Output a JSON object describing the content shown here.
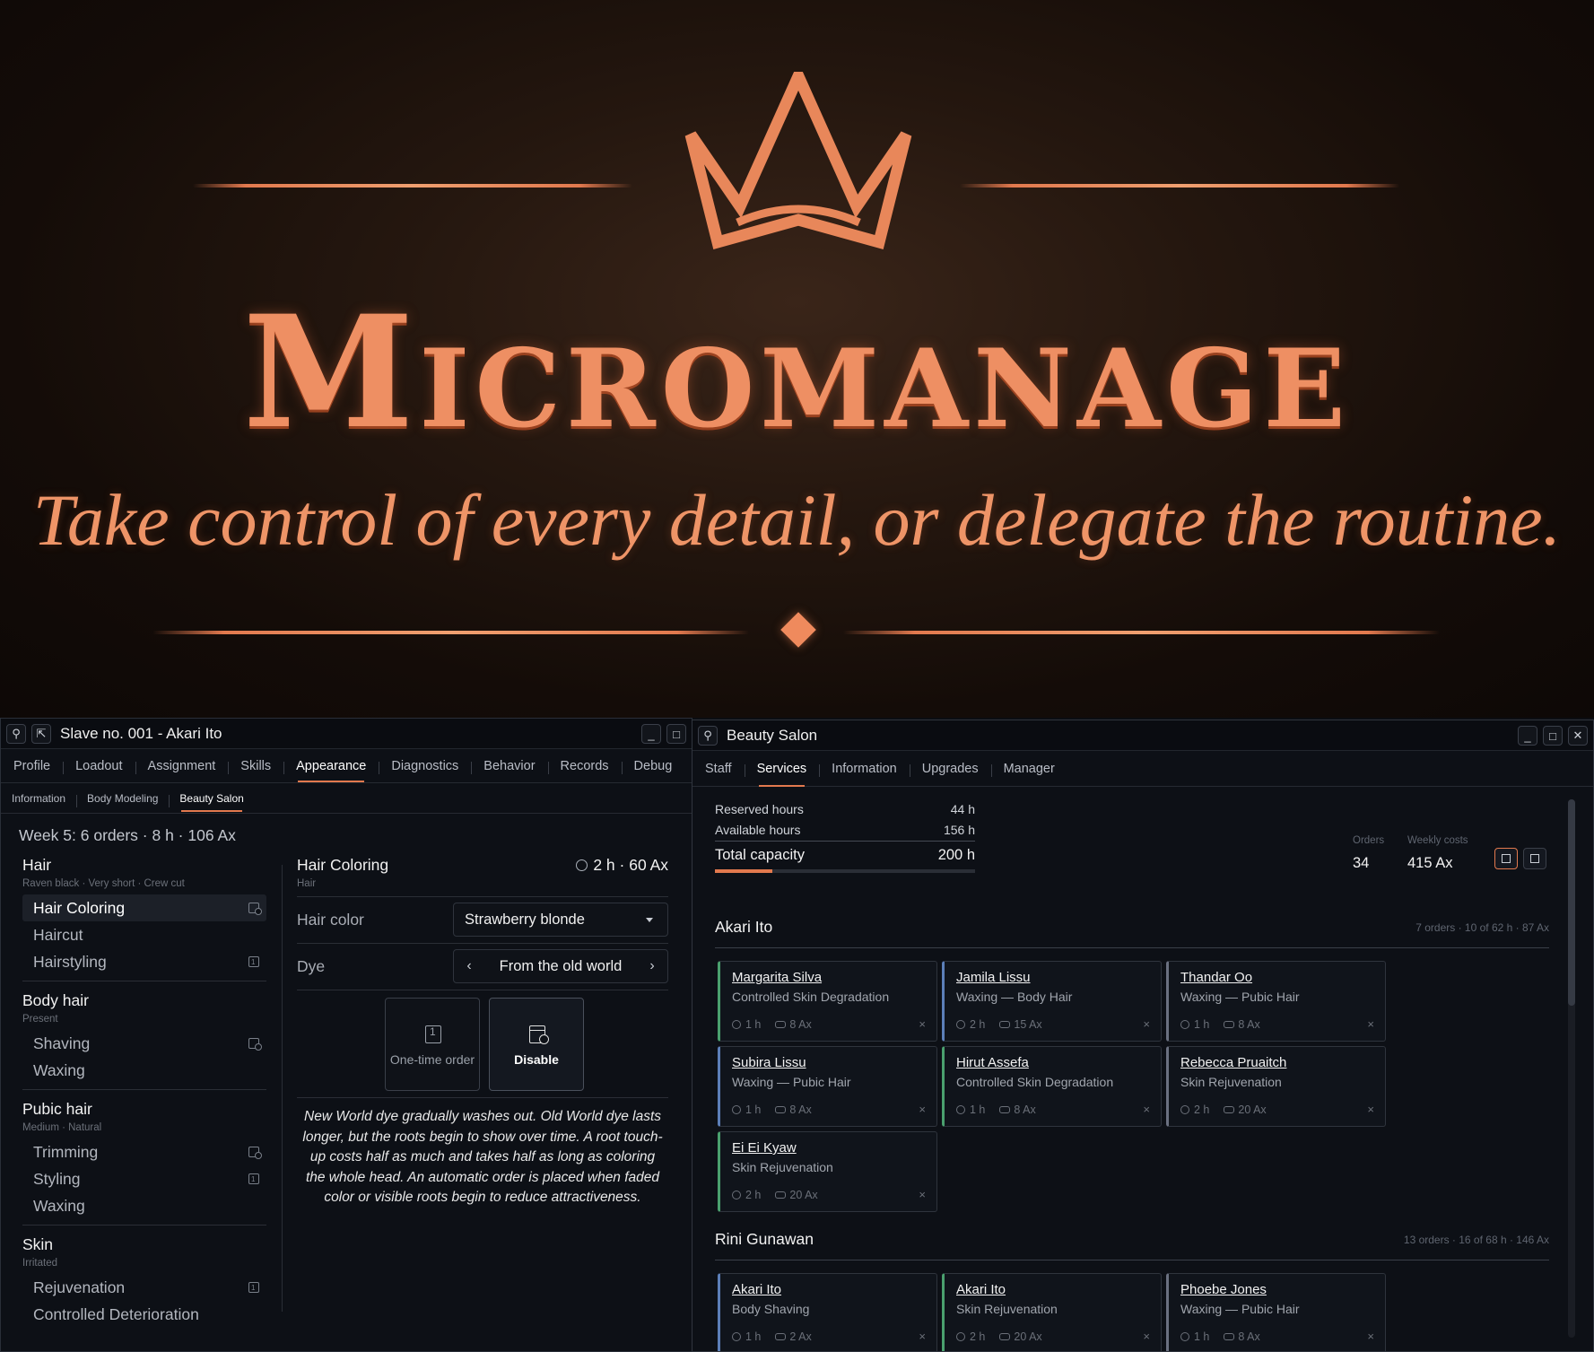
{
  "hero": {
    "title": "Micromanage",
    "tagline": "Take control of every detail, or delegate the routine.",
    "accent_color": "#e2794e"
  },
  "left_window": {
    "title": "Slave no. 001 - Akari Ito",
    "icons": [
      "pin-icon",
      "popout-icon",
      "minimize-icon",
      "maximize-icon",
      "close-icon"
    ],
    "tabs": [
      "Profile",
      "Loadout",
      "Assignment",
      "Skills",
      "Appearance",
      "Diagnostics",
      "Behavior",
      "Records",
      "Debug"
    ],
    "active_tab": "Appearance",
    "subtabs": [
      "Information",
      "Body Modeling",
      "Beauty Salon"
    ],
    "active_subtab": "Beauty Salon",
    "week_summary": "Week 5: 6 orders · 8 h · 106 Ax",
    "categories": [
      {
        "name": "Hair",
        "desc": "Raven black · Very short · Crew cut",
        "items": [
          {
            "label": "Hair Coloring",
            "icon": "calendar-icon",
            "selected": true
          },
          {
            "label": "Haircut",
            "icon": ""
          },
          {
            "label": "Hairstyling",
            "icon": "one-time-icon"
          }
        ]
      },
      {
        "name": "Body hair",
        "desc": "Present",
        "items": [
          {
            "label": "Shaving",
            "icon": "calendar-icon"
          },
          {
            "label": "Waxing",
            "icon": ""
          }
        ]
      },
      {
        "name": "Pubic hair",
        "desc": "Medium · Natural",
        "items": [
          {
            "label": "Trimming",
            "icon": "calendar-icon"
          },
          {
            "label": "Styling",
            "icon": "one-time-icon"
          },
          {
            "label": "Waxing",
            "icon": ""
          }
        ]
      },
      {
        "name": "Skin",
        "desc": "Irritated",
        "items": [
          {
            "label": "Rejuvenation",
            "icon": "one-time-icon"
          },
          {
            "label": "Controlled Deterioration",
            "icon": ""
          }
        ]
      }
    ],
    "detail": {
      "title": "Hair Coloring",
      "meta": "2 h · 60 Ax",
      "subtitle": "Hair",
      "hair_color_label": "Hair color",
      "hair_color_value": "Strawberry blonde",
      "dye_label": "Dye",
      "dye_value": "From the old world",
      "one_time_label": "One-time order",
      "disable_label": "Disable",
      "description": "New World dye gradually washes out. Old World dye lasts longer, but the roots begin to show over time. A root touch-up costs half as much and takes half as long as coloring the whole head. An automatic order is placed when faded color or visible roots begin to reduce attractiveness."
    }
  },
  "right_window": {
    "title": "Beauty Salon",
    "tabs": [
      "Staff",
      "Services",
      "Information",
      "Upgrades",
      "Manager"
    ],
    "active_tab": "Services",
    "capacity": {
      "reserved_label": "Reserved hours",
      "reserved_value": "44 h",
      "available_label": "Available hours",
      "available_value": "156 h",
      "total_label": "Total capacity",
      "total_value": "200 h",
      "used_fraction": 0.22
    },
    "orders_label": "Orders",
    "orders_value": "34",
    "costs_label": "Weekly costs",
    "costs_value": "415 Ax",
    "staff": [
      {
        "name": "Akari Ito",
        "summary": "7 orders · 10 of 62 h · 87 Ax",
        "cards": [
          {
            "who": "Margarita Silva",
            "service": "Controlled Skin Degradation",
            "hours": "1 h",
            "cost": "8 Ax",
            "color": "green"
          },
          {
            "who": "Jamila Lissu",
            "service": "Waxing — Body Hair",
            "hours": "2 h",
            "cost": "15 Ax",
            "color": "blue"
          },
          {
            "who": "Thandar Oo",
            "service": "Waxing — Pubic Hair",
            "hours": "1 h",
            "cost": "8 Ax",
            "color": "gray"
          },
          {
            "who": "Subira Lissu",
            "service": "Waxing — Pubic Hair",
            "hours": "1 h",
            "cost": "8 Ax",
            "color": "blue"
          },
          {
            "who": "Hirut Assefa",
            "service": "Controlled Skin Degradation",
            "hours": "1 h",
            "cost": "8 Ax",
            "color": "green"
          },
          {
            "who": "Rebecca Pruaitch",
            "service": "Skin Rejuvenation",
            "hours": "2 h",
            "cost": "20 Ax",
            "color": "gray"
          },
          {
            "who": "Ei Ei Kyaw",
            "service": "Skin Rejuvenation",
            "hours": "2 h",
            "cost": "20 Ax",
            "color": "green"
          }
        ]
      },
      {
        "name": "Rini Gunawan",
        "summary": "13 orders · 16 of 68 h · 146 Ax",
        "cards": [
          {
            "who": "Akari Ito",
            "service": "Body Shaving",
            "hours": "1 h",
            "cost": "2 Ax",
            "color": "blue"
          },
          {
            "who": "Akari Ito",
            "service": "Skin Rejuvenation",
            "hours": "2 h",
            "cost": "20 Ax",
            "color": "green"
          },
          {
            "who": "Phoebe Jones",
            "service": "Waxing — Pubic Hair",
            "hours": "1 h",
            "cost": "8 Ax",
            "color": "gray"
          }
        ]
      }
    ]
  }
}
